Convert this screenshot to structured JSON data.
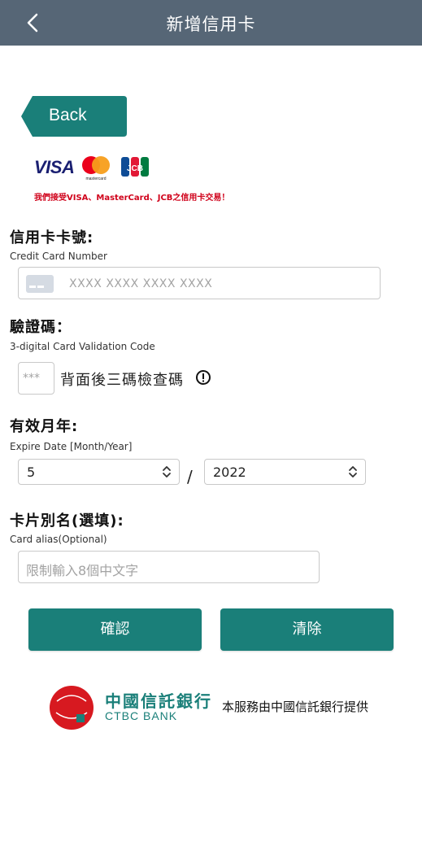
{
  "header": {
    "title": "新增信用卡"
  },
  "back_button": {
    "label": "Back"
  },
  "brands": {
    "visa": "VISA",
    "mastercard": "mastercard",
    "jcb": "JCB",
    "accept_note": "我們接受VISA、MasterCard、JCB之信用卡交易！"
  },
  "card_number": {
    "label_zh": "信用卡卡號:",
    "label_en": "Credit Card Number",
    "placeholder": "XXXX XXXX XXXX XXXX"
  },
  "cvv": {
    "label_zh": "驗證碼：",
    "label_en": "3-digital Card Validation Code",
    "placeholder": "***",
    "hint": "背面後三碼檢查碼"
  },
  "expiry": {
    "label_zh": "有效月年:",
    "label_en": "Expire Date [Month/Year]",
    "month": "5",
    "separator": "/",
    "year": "2022"
  },
  "alias": {
    "label_zh": "卡片別名(選填):",
    "label_en": "Card alias(Optional)",
    "placeholder": "限制輸入8個中文字"
  },
  "actions": {
    "confirm": "確認",
    "clear": "清除"
  },
  "footer": {
    "bank_name_zh": "中國信託銀行",
    "bank_name_en": "CTBC BANK",
    "note": "本服務由中國信託銀行提供"
  },
  "colors": {
    "header": "#566676",
    "accent": "#1a7f79",
    "warning": "#d0021b"
  }
}
